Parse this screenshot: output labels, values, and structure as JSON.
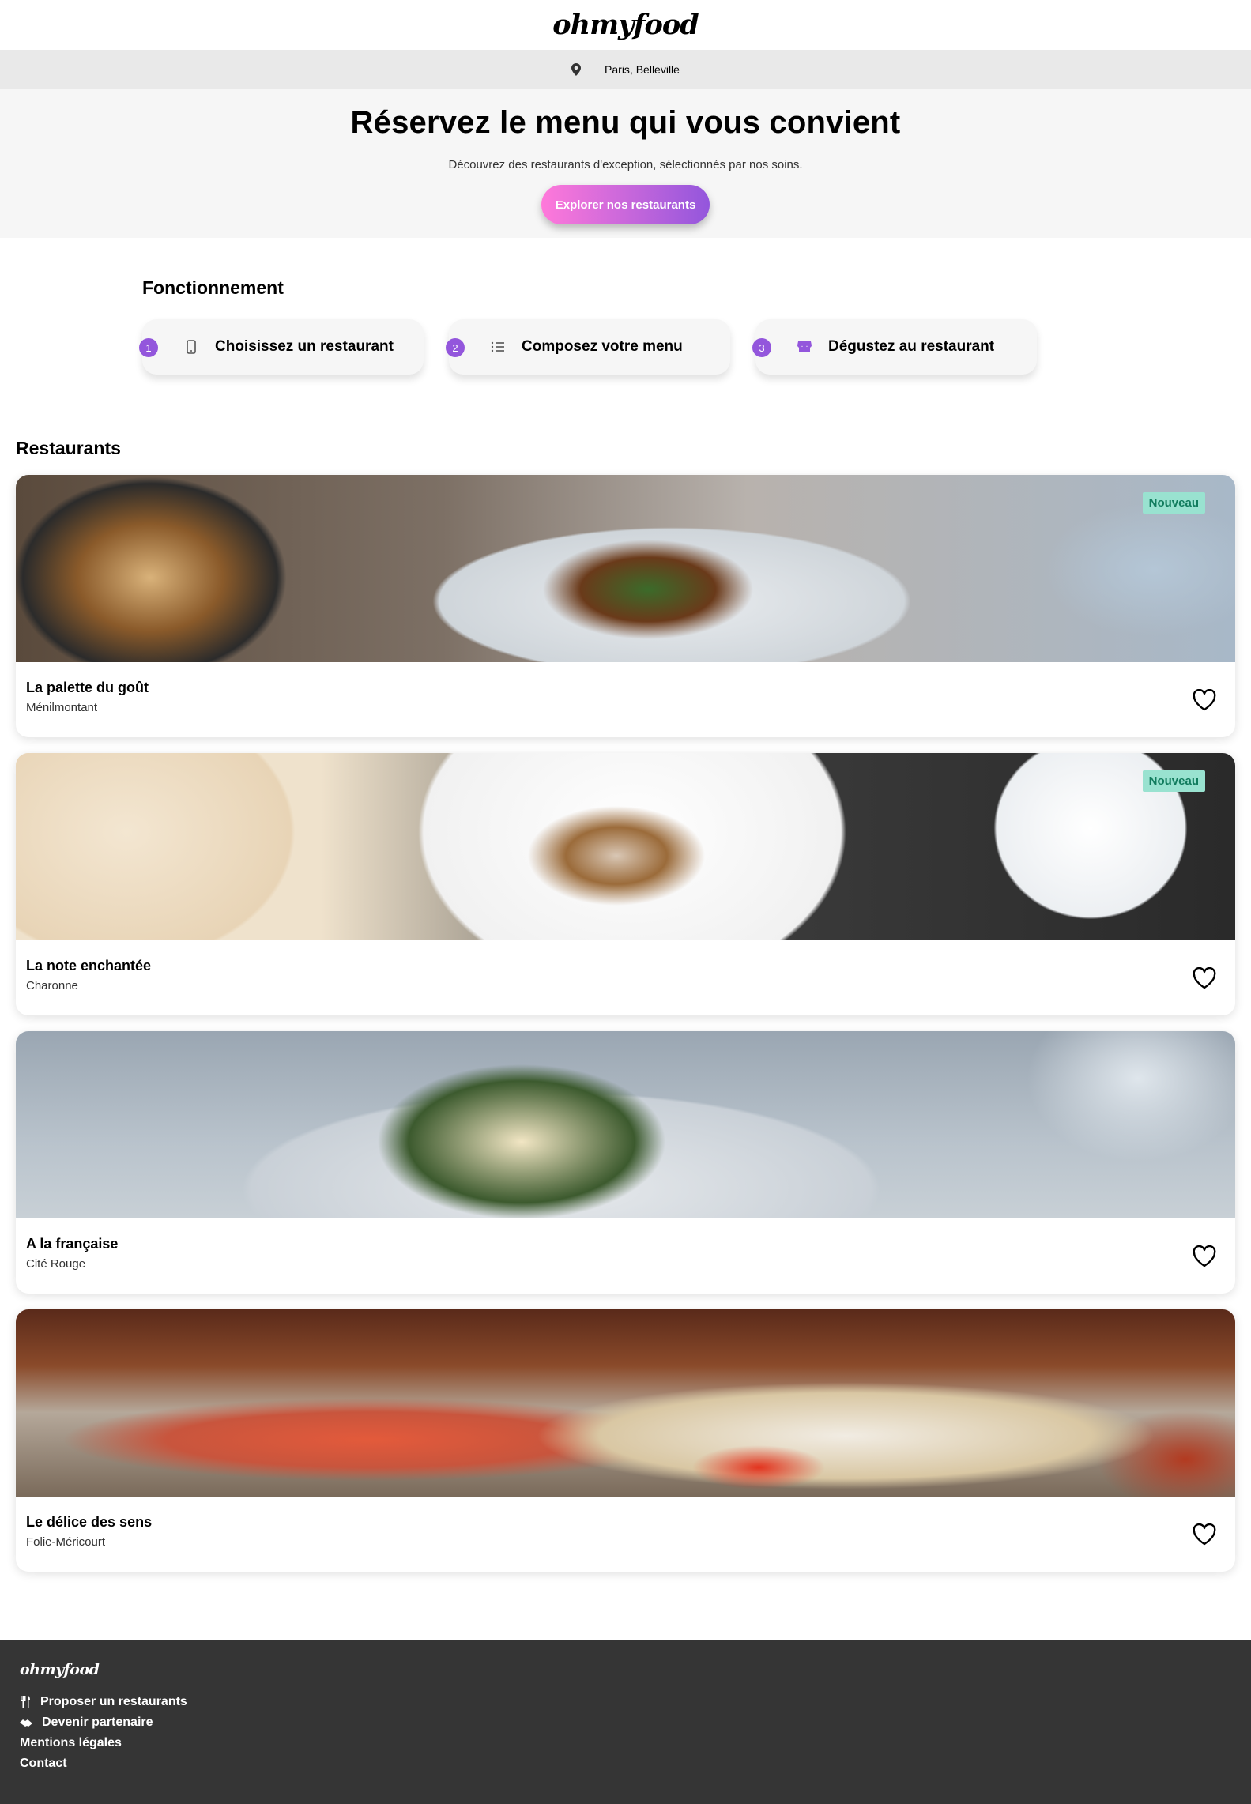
{
  "header": {
    "logo": "ohmyfood"
  },
  "location": {
    "text": "Paris, Belleville",
    "icon": "location-pin-icon"
  },
  "hero": {
    "title": "Réservez le menu qui vous convient",
    "subtitle": "Découvrez des restaurants d'exception, sélectionnés par nos soins.",
    "button_label": "Explorer nos restaurants"
  },
  "how": {
    "title": "Fonctionnement",
    "steps": [
      {
        "number": "1",
        "label": "Choisissez un restaurant",
        "icon": "mobile-phone-icon"
      },
      {
        "number": "2",
        "label": "Composez votre menu",
        "icon": "list-icon"
      },
      {
        "number": "3",
        "label": "Dégustez au restaurant",
        "icon": "store-icon"
      }
    ]
  },
  "restaurants": {
    "title": "Restaurants",
    "items": [
      {
        "name": "La palette du goût",
        "location": "Ménilmontant",
        "badge": "Nouveau"
      },
      {
        "name": "La note enchantée",
        "location": "Charonne",
        "badge": "Nouveau"
      },
      {
        "name": "A la française",
        "location": "Cité Rouge",
        "badge": ""
      },
      {
        "name": "Le délice des sens",
        "location": "Folie-Méricourt",
        "badge": ""
      }
    ]
  },
  "footer": {
    "logo": "ohmyfood",
    "links": [
      {
        "label": "Proposer un restaurants",
        "icon": "utensils-icon"
      },
      {
        "label": "Devenir partenaire",
        "icon": "handshake-icon"
      },
      {
        "label": "Mentions légales",
        "icon": ""
      },
      {
        "label": "Contact",
        "icon": ""
      }
    ]
  },
  "colors": {
    "primary": "#9356dc",
    "secondary": "#ff79da",
    "badge_bg": "#99e2d0",
    "badge_text": "#127c5e",
    "footer_bg": "#353535"
  }
}
